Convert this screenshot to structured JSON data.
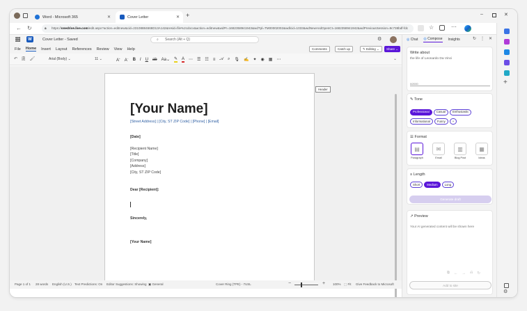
{
  "browser": {
    "tabs": [
      {
        "label": "Word - Microsoft 365",
        "active": false
      },
      {
        "label": "Cover Letter",
        "active": true
      }
    ],
    "new_tab_icon": "plus-icon",
    "url_prefix": "https://",
    "url_host": "onedrive.live.com",
    "url_rest": "/edit.aspx?action=editnew&cid=23108884668D13A142&resid=file%2cdocx&action=editnew&wdPr=1682358941943&wdTpl=TM00002002&wdlcid=1033&wdNewAndOpenCt=1682358941942&wdPreviousSession=9c738bdf-fdc"
  },
  "word": {
    "doc_title": "Cover Letter - Saved",
    "search_placeholder": "Search (Alt + Q)",
    "menu": [
      "File",
      "Home",
      "Insert",
      "Layout",
      "References",
      "Review",
      "View",
      "Help"
    ],
    "active_menu": "Home",
    "comments_label": "Comments",
    "catchup_label": "Catch up",
    "editing_label": "Editing",
    "share_label": "Share",
    "font_name": "Arial (Body)",
    "font_size": "11",
    "tooltip": "Header"
  },
  "document": {
    "name": "[Your Name]",
    "address_line": "[Street Address] | [City, ST ZIP Code] | [Phone] | [Email]",
    "date": "[Date]",
    "recipient_lines": [
      "[Recipient Name]",
      "[Title]",
      "[Company]",
      "[Address]",
      "[City, ST ZIP Code]"
    ],
    "salutation": "Dear [Recipient]:",
    "closing": "Sincerely,",
    "signature": "[Your Name]"
  },
  "status": {
    "page": "Page 1 of 1",
    "words": "28 words",
    "language": "English (U.S.)",
    "predictions": "Text Predictions: On",
    "editor": "Editor Suggestions: Showing",
    "general": "General",
    "cover_ring": "Cover Ring (TPE) - 7USL",
    "zoom": "100%",
    "fit": "Fit",
    "feedback": "Give Feedback to Microsoft"
  },
  "copilot": {
    "tabs": [
      "Chat",
      "Compose",
      "Insights"
    ],
    "active_tab": "Compose",
    "write_about_label": "Write about",
    "write_about_value": "the life of Leonardo Da Vinci",
    "char_count": "0/2000",
    "tone_label": "Tone",
    "tones": [
      "Professional",
      "Casual",
      "Enthusiastic",
      "Informational",
      "Funny"
    ],
    "selected_tone": "Professional",
    "format_label": "Format",
    "formats": [
      "Paragraph",
      "Email",
      "Blog Post",
      "Ideas"
    ],
    "selected_format": "Paragraph",
    "length_label": "Length",
    "lengths": [
      "Short",
      "Medium",
      "Long"
    ],
    "selected_length": "Medium",
    "generate_label": "Generate draft",
    "preview_label": "Preview",
    "preview_placeholder": "Your AI generated content will be shown here",
    "add_to_site_label": "Add to site"
  },
  "colors": {
    "accent": "#5a16d9",
    "word_blue": "#185abd",
    "edge_blue": "#0c59a4"
  }
}
